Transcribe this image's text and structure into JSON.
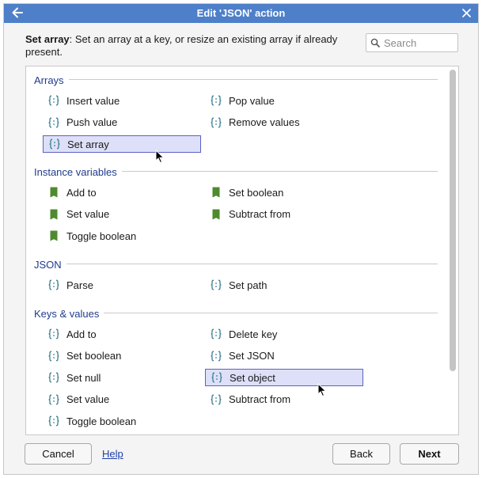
{
  "window": {
    "title": "Edit 'JSON' action",
    "accent_color": "#4e7fc9"
  },
  "description": {
    "label": "Set array",
    "text": ": Set an array at a key, or resize an existing array if already present."
  },
  "search": {
    "placeholder": "Search",
    "value": ""
  },
  "sections": [
    {
      "title": "Arrays",
      "items": [
        {
          "label": "Insert value",
          "icon": "braces-icon"
        },
        {
          "label": "Pop value",
          "icon": "braces-icon"
        },
        {
          "label": "Push value",
          "icon": "braces-icon"
        },
        {
          "label": "Remove values",
          "icon": "braces-icon"
        },
        {
          "label": "Set array",
          "icon": "braces-icon",
          "selected": true
        }
      ]
    },
    {
      "title": "Instance variables",
      "items": [
        {
          "label": "Add to",
          "icon": "variable-tag-icon"
        },
        {
          "label": "Set boolean",
          "icon": "variable-tag-icon"
        },
        {
          "label": "Set value",
          "icon": "variable-tag-icon"
        },
        {
          "label": "Subtract from",
          "icon": "variable-tag-icon"
        },
        {
          "label": "Toggle boolean",
          "icon": "variable-tag-icon"
        }
      ]
    },
    {
      "title": "JSON",
      "items": [
        {
          "label": "Parse",
          "icon": "braces-icon"
        },
        {
          "label": "Set path",
          "icon": "braces-icon"
        }
      ]
    },
    {
      "title": "Keys & values",
      "items": [
        {
          "label": "Add to",
          "icon": "braces-icon"
        },
        {
          "label": "Delete key",
          "icon": "braces-icon"
        },
        {
          "label": "Set boolean",
          "icon": "braces-icon"
        },
        {
          "label": "Set JSON",
          "icon": "braces-icon"
        },
        {
          "label": "Set null",
          "icon": "braces-icon"
        },
        {
          "label": "Set object",
          "icon": "braces-icon",
          "selected": true
        },
        {
          "label": "Set value",
          "icon": "braces-icon"
        },
        {
          "label": "Subtract from",
          "icon": "braces-icon"
        },
        {
          "label": "Toggle boolean",
          "icon": "braces-icon"
        }
      ]
    }
  ],
  "footer": {
    "cancel_label": "Cancel",
    "help_label": "Help",
    "back_label": "Back",
    "next_label": "Next"
  },
  "colors": {
    "section_title": "#1f3c8c",
    "braces_icon": "#3d7f93",
    "variable_icon": "#4f8a2f",
    "selection_fill": "#dde0f8",
    "selection_border": "#5c62c2"
  }
}
